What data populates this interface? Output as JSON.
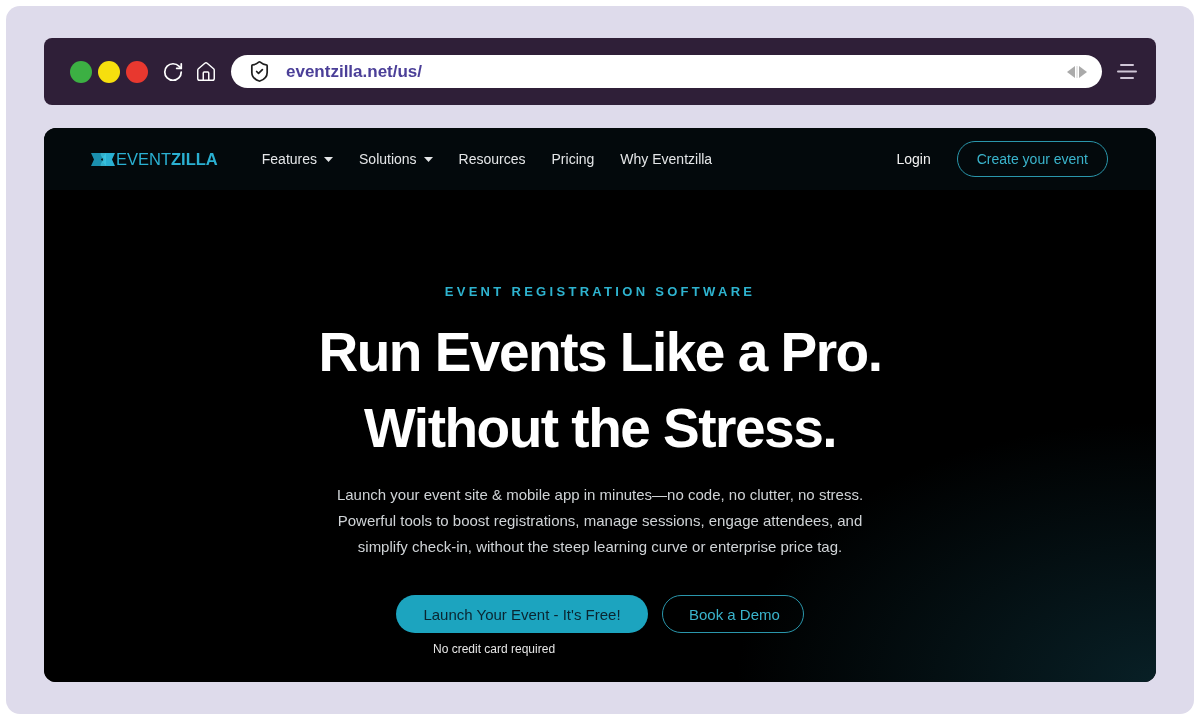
{
  "browser": {
    "window_controls": [
      {
        "color": "#3cb043"
      },
      {
        "color": "#f6df0e"
      },
      {
        "color": "#e8382f"
      }
    ],
    "url": "eventzilla.net/us/"
  },
  "site": {
    "logo": "EVENT**ZILLA**",
    "nav": [
      {
        "label": "Features",
        "has_menu": true
      },
      {
        "label": "Solutions",
        "has_menu": true
      },
      {
        "label": "Resources",
        "has_menu": false
      },
      {
        "label": "Pricing",
        "has_menu": false
      },
      {
        "label": "Why Eventzilla",
        "has_menu": false
      }
    ],
    "login": "Login",
    "cta_button": "Create your event"
  },
  "hero": {
    "eyebrow": "EVENT REGISTRATION SOFTWARE",
    "headline": "Run Events Like a Pro. Without the Stress.",
    "description": "Launch your event site & mobile app in minutes—no code, no clutter, no stress. Powerful tools to boost registrations, manage sessions, engage attendees, and simplify check-in, without the steep learning curve or enterprise price tag.",
    "primary_button": "Launch Your Event - It's Free!",
    "secondary_button": "Book a Demo",
    "note": "No credit card required"
  }
}
